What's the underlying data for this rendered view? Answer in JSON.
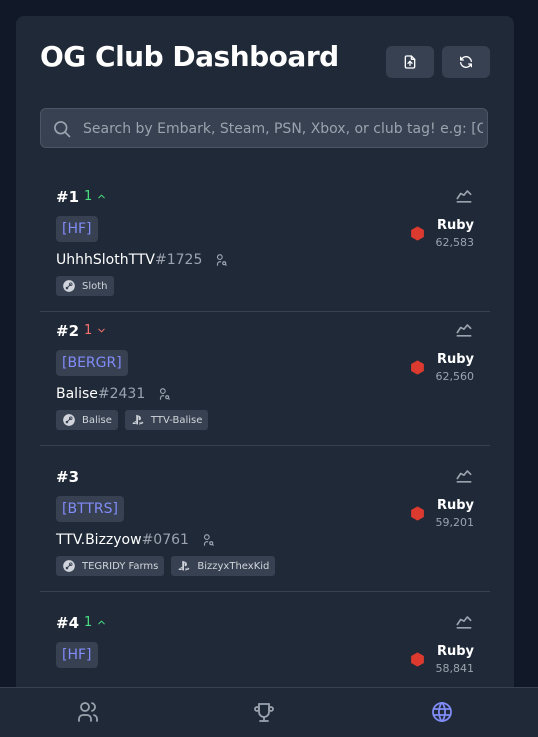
{
  "header": {
    "title": "OG Club Dashboard"
  },
  "search": {
    "placeholder": "Search by Embark, Steam, PSN, Xbox, or club tag! e.g: [OG]"
  },
  "icons": {
    "export": "file-export-icon",
    "refresh": "refresh-icon",
    "search": "search-icon",
    "chart": "chart-line-icon",
    "user": "user-search-icon",
    "steam": "steam-icon",
    "playstation": "playstation-icon",
    "members": "users-icon",
    "leaderboard": "trophy-icon",
    "global": "globe-icon"
  },
  "colors": {
    "background": "#111827",
    "panel": "#1f2937",
    "tag": "#818cf8",
    "up": "#4ade80",
    "down": "#f87171",
    "ruby": "#dc3a2f",
    "active_nav": "#818cf8"
  },
  "entries": [
    {
      "rank": "#1",
      "change": "1",
      "direction": "up",
      "tag": "[HF]",
      "name": "UhhhSlothTTV",
      "discriminator": "#1725",
      "league": "Ruby",
      "score": "62,583",
      "platforms": [
        {
          "type": "steam",
          "label": "Sloth"
        }
      ]
    },
    {
      "rank": "#2",
      "change": "1",
      "direction": "down",
      "tag": "[BERGR]",
      "name": "Balise",
      "discriminator": "#2431",
      "league": "Ruby",
      "score": "62,560",
      "platforms": [
        {
          "type": "steam",
          "label": "Balise"
        },
        {
          "type": "playstation",
          "label": "TTV-Balise"
        }
      ]
    },
    {
      "rank": "#3",
      "change": "",
      "direction": "none",
      "tag": "[BTTRS]",
      "name": "TTV.Bizzyow",
      "discriminator": "#0761",
      "league": "Ruby",
      "score": "59,201",
      "platforms": [
        {
          "type": "steam",
          "label": "TEGRIDY Farms"
        },
        {
          "type": "playstation",
          "label": "BizzyxThexKid"
        }
      ]
    },
    {
      "rank": "#4",
      "change": "1",
      "direction": "up",
      "tag": "[HF]",
      "name": "",
      "discriminator": "",
      "league": "Ruby",
      "score": "58,841",
      "platforms": []
    }
  ],
  "nav": {
    "active": "global"
  }
}
